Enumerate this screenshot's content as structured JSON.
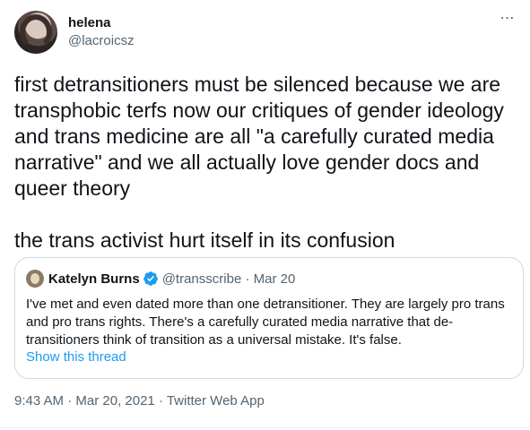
{
  "author": {
    "display_name": "helena",
    "handle": "@lacroicsz"
  },
  "more_icon": "⋯",
  "tweet_text": "first detransitioners must be silenced because we are transphobic terfs now our critiques of gender ideology and trans medicine are all \"a carefully curated media narrative\" and we all actually love gender docs and queer theory\n\nthe trans activist hurt itself in its confusion",
  "quoted_tweet": {
    "display_name": "Katelyn Burns",
    "handle_and_date": "@transscribe · Mar 20",
    "body": "I've met and even dated more than one detransitioner. They are largely pro trans and pro trans rights. There's a carefully curated media narrative that de-transitioners think of transition as a universal mistake. It's false.",
    "show_thread": "Show this thread"
  },
  "meta": {
    "time": "9:43 AM",
    "separator": " · ",
    "date": "Mar 20, 2021",
    "source": "Twitter Web App"
  },
  "colors": {
    "text": "#0f1419",
    "secondary": "#536471",
    "link": "#1d9bf0",
    "border": "#cfd9de"
  }
}
